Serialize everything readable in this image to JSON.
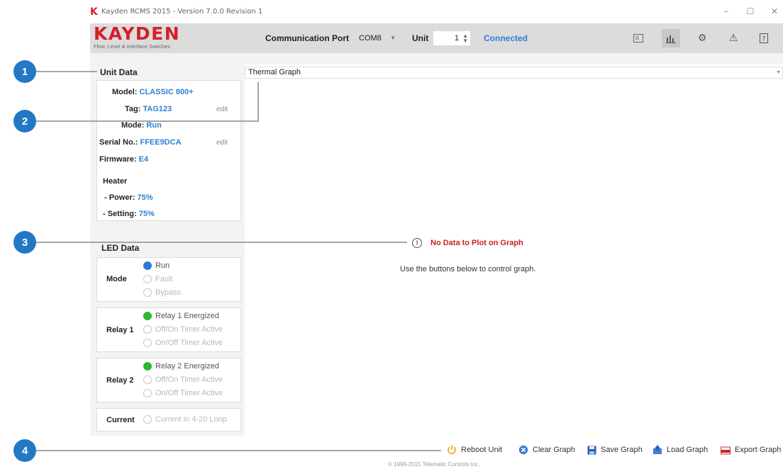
{
  "window": {
    "title": "Kayden RCMS 2015 - Version 7.0.0 Revision 1",
    "logo_letter": "K",
    "minimize": "–",
    "maximize": "☐",
    "close": "✕"
  },
  "header": {
    "brand": "KAYDEN",
    "tagline": "Flow, Level & Interface Switches",
    "comm_port_label": "Communication Port",
    "comm_port_value": "COM8",
    "unit_label": "Unit",
    "unit_value": "1",
    "status": "Connected",
    "toolbar_icons": [
      "panel-icon",
      "chart-icon",
      "gear-icon",
      "warning-icon",
      "help-icon"
    ],
    "active_tool": "chart-icon"
  },
  "unit_data": {
    "title": "Unit Data",
    "model_label": "Model",
    "model_value": "CLASSIC 800+",
    "tag_label": "Tag",
    "tag_value": "TAG123",
    "mode_label": "Mode",
    "mode_value": "Run",
    "serial_label": "Serial No.",
    "serial_value": "FFEE9DCA",
    "firmware_label": "Firmware",
    "firmware_value": "E4",
    "heater_label": "Heater",
    "power_label": "- Power",
    "power_value": "75%",
    "setting_label": "- Setting",
    "setting_value": "75%",
    "edit_label": "edit"
  },
  "led_data": {
    "title": "LED Data",
    "mode": {
      "label": "Mode",
      "items": [
        {
          "text": "Run",
          "on": true
        },
        {
          "text": "Fault",
          "on": false
        },
        {
          "text": "Bypass",
          "on": false
        }
      ]
    },
    "relay1": {
      "label": "Relay 1",
      "items": [
        {
          "text": "Relay 1 Energized",
          "on": true
        },
        {
          "text": "Off/On Timer Active",
          "on": false
        },
        {
          "text": "On/Off Timer Active",
          "on": false
        }
      ]
    },
    "relay2": {
      "label": "Relay 2",
      "items": [
        {
          "text": "Relay 2 Energized",
          "on": true
        },
        {
          "text": "Off/On Timer Active",
          "on": false
        },
        {
          "text": "On/Off Timer Active",
          "on": false
        }
      ]
    },
    "current": {
      "label": "Current",
      "items": [
        {
          "text": "Current in 4-20 Loop",
          "on": false
        }
      ]
    }
  },
  "graph": {
    "selected": "Thermal Graph",
    "no_data": "No Data to Plot on Graph",
    "hint": "Use the buttons below to control graph."
  },
  "bottom": {
    "reboot": "Reboot Unit",
    "clear": "Clear Graph",
    "save": "Save Graph",
    "load": "Load Graph",
    "export": "Export Graph",
    "copyright": "© 1996-2015 Telematic Controls Inc."
  },
  "callouts": [
    "1",
    "2",
    "3",
    "4"
  ],
  "colors": {
    "brand_red": "#d4202a",
    "value_blue": "#2d7fd3",
    "led_blue": "#2b7bd6",
    "led_green": "#2eb82e",
    "error_red": "#cc1f1f",
    "callout_blue": "#2278c3"
  }
}
